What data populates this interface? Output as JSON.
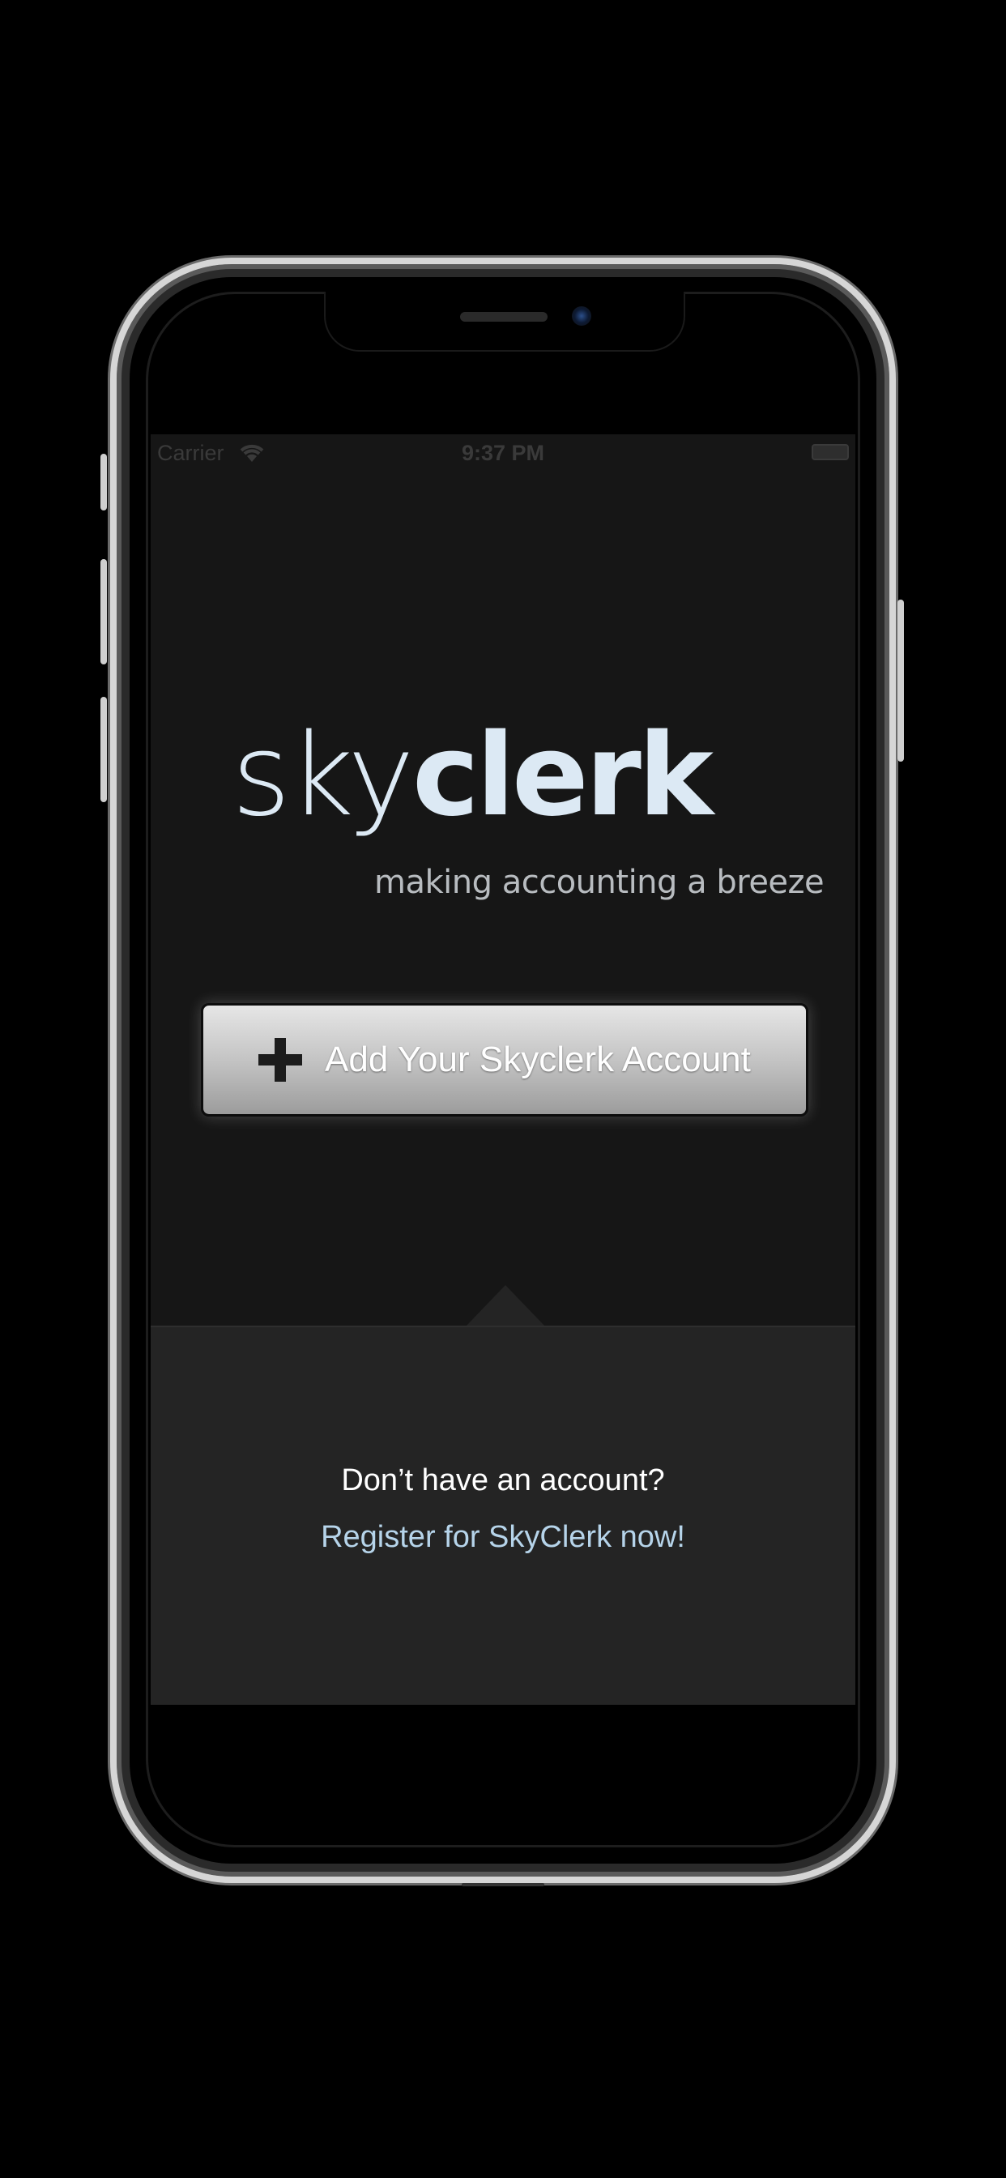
{
  "status_bar": {
    "carrier": "Carrier",
    "time": "9:37 PM"
  },
  "logo": {
    "part_light": "sky",
    "part_bold": "clerk",
    "tagline": "making accounting a breeze"
  },
  "actions": {
    "add_account_label": "Add Your Skyclerk Account"
  },
  "register": {
    "prompt": "Don’t have an account?",
    "link_label": "Register for SkyClerk now!"
  },
  "colors": {
    "background": "#161616",
    "panel": "#242424",
    "logo": "#dce9f4",
    "link": "#b6d4ea"
  }
}
